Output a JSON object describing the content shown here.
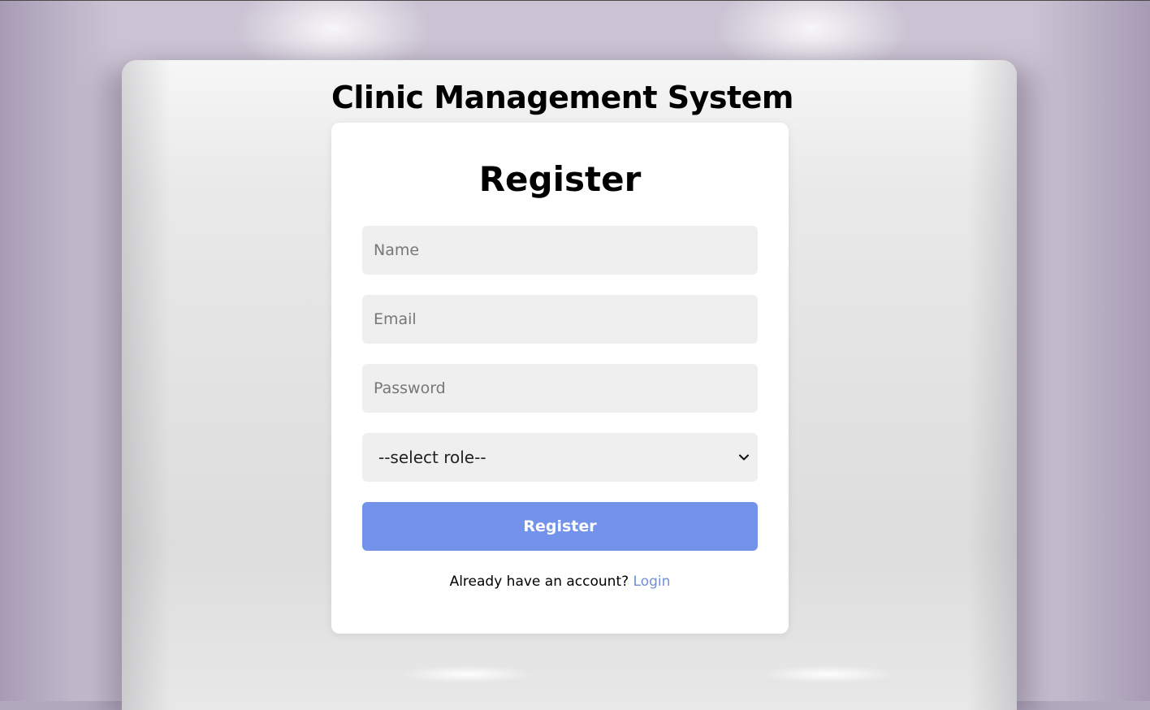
{
  "header": {
    "app_title": "Clinic Management System"
  },
  "form": {
    "title": "Register",
    "name_placeholder": "Name",
    "email_placeholder": "Email",
    "password_placeholder": "Password",
    "role_selected": "--select role--",
    "submit_label": "Register",
    "footer_text": "Already have an account?",
    "login_link": "Login"
  },
  "icons": {
    "select_arrow": "chevron-down-icon"
  },
  "colors": {
    "primary_button": "#7393ea",
    "link": "#6f8fd8",
    "input_background": "#efefef"
  }
}
